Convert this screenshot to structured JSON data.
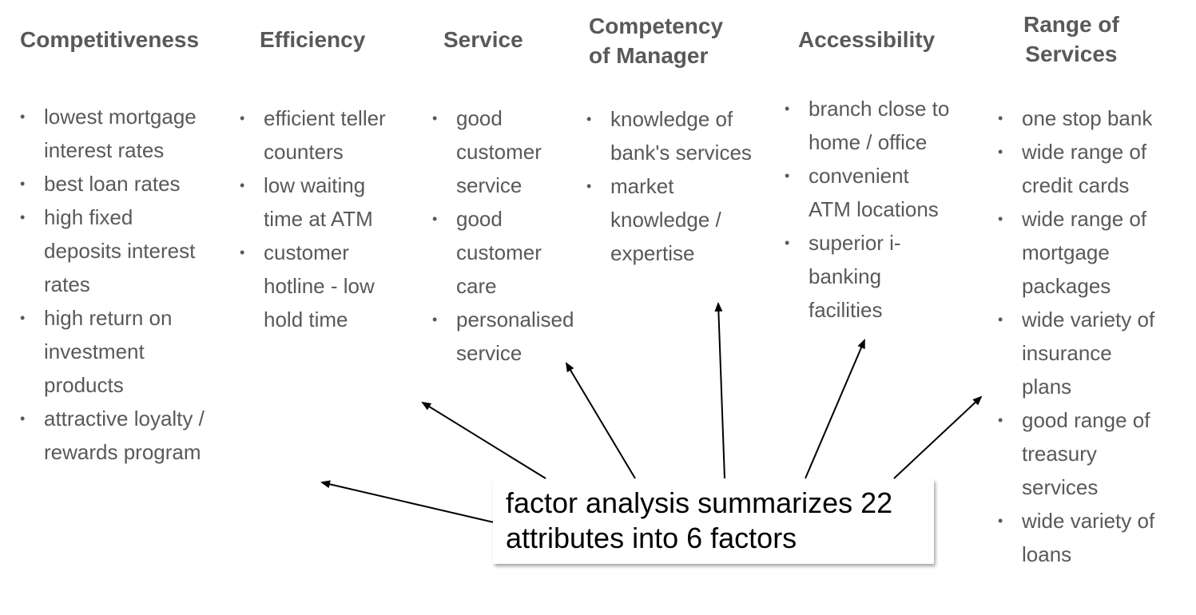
{
  "factors": [
    {
      "title": "Competitiveness",
      "items": [
        "lowest mortgage\ninterest rates",
        "best loan rates",
        "high fixed\ndeposits interest\nrates",
        "high return on\ninvestment\nproducts",
        "attractive loyalty /\nrewards program"
      ]
    },
    {
      "title": "Efficiency",
      "items": [
        "efficient teller\ncounters",
        "low waiting\ntime at ATM",
        "customer\nhotline - low\nhold time"
      ]
    },
    {
      "title": "Service",
      "items": [
        "good\ncustomer\nservice",
        "good\ncustomer\ncare",
        "personalised\nservice"
      ]
    },
    {
      "title": "Competency\nof  Manager",
      "items": [
        "knowledge of\nbank's services",
        "market\nknowledge /\nexpertise"
      ]
    },
    {
      "title": "Accessibility",
      "items": [
        "branch close to\nhome / office",
        "convenient\nATM locations",
        "superior i-\nbanking\nfacilities"
      ]
    },
    {
      "title": "Range of\nServices",
      "items": [
        "one stop bank",
        "wide range of\ncredit cards",
        "wide range of\nmortgage\npackages",
        "wide variety of\ninsurance\nplans",
        "good range of\ntreasury\nservices",
        "wide variety of\nloans"
      ]
    }
  ],
  "bullet_glyph": "•",
  "callout": {
    "text": "factor analysis summarizes 22\nattributes into 6 factors"
  },
  "colors": {
    "text_gray": "#595959",
    "arrow": "#000000",
    "callout_text": "#000000"
  }
}
